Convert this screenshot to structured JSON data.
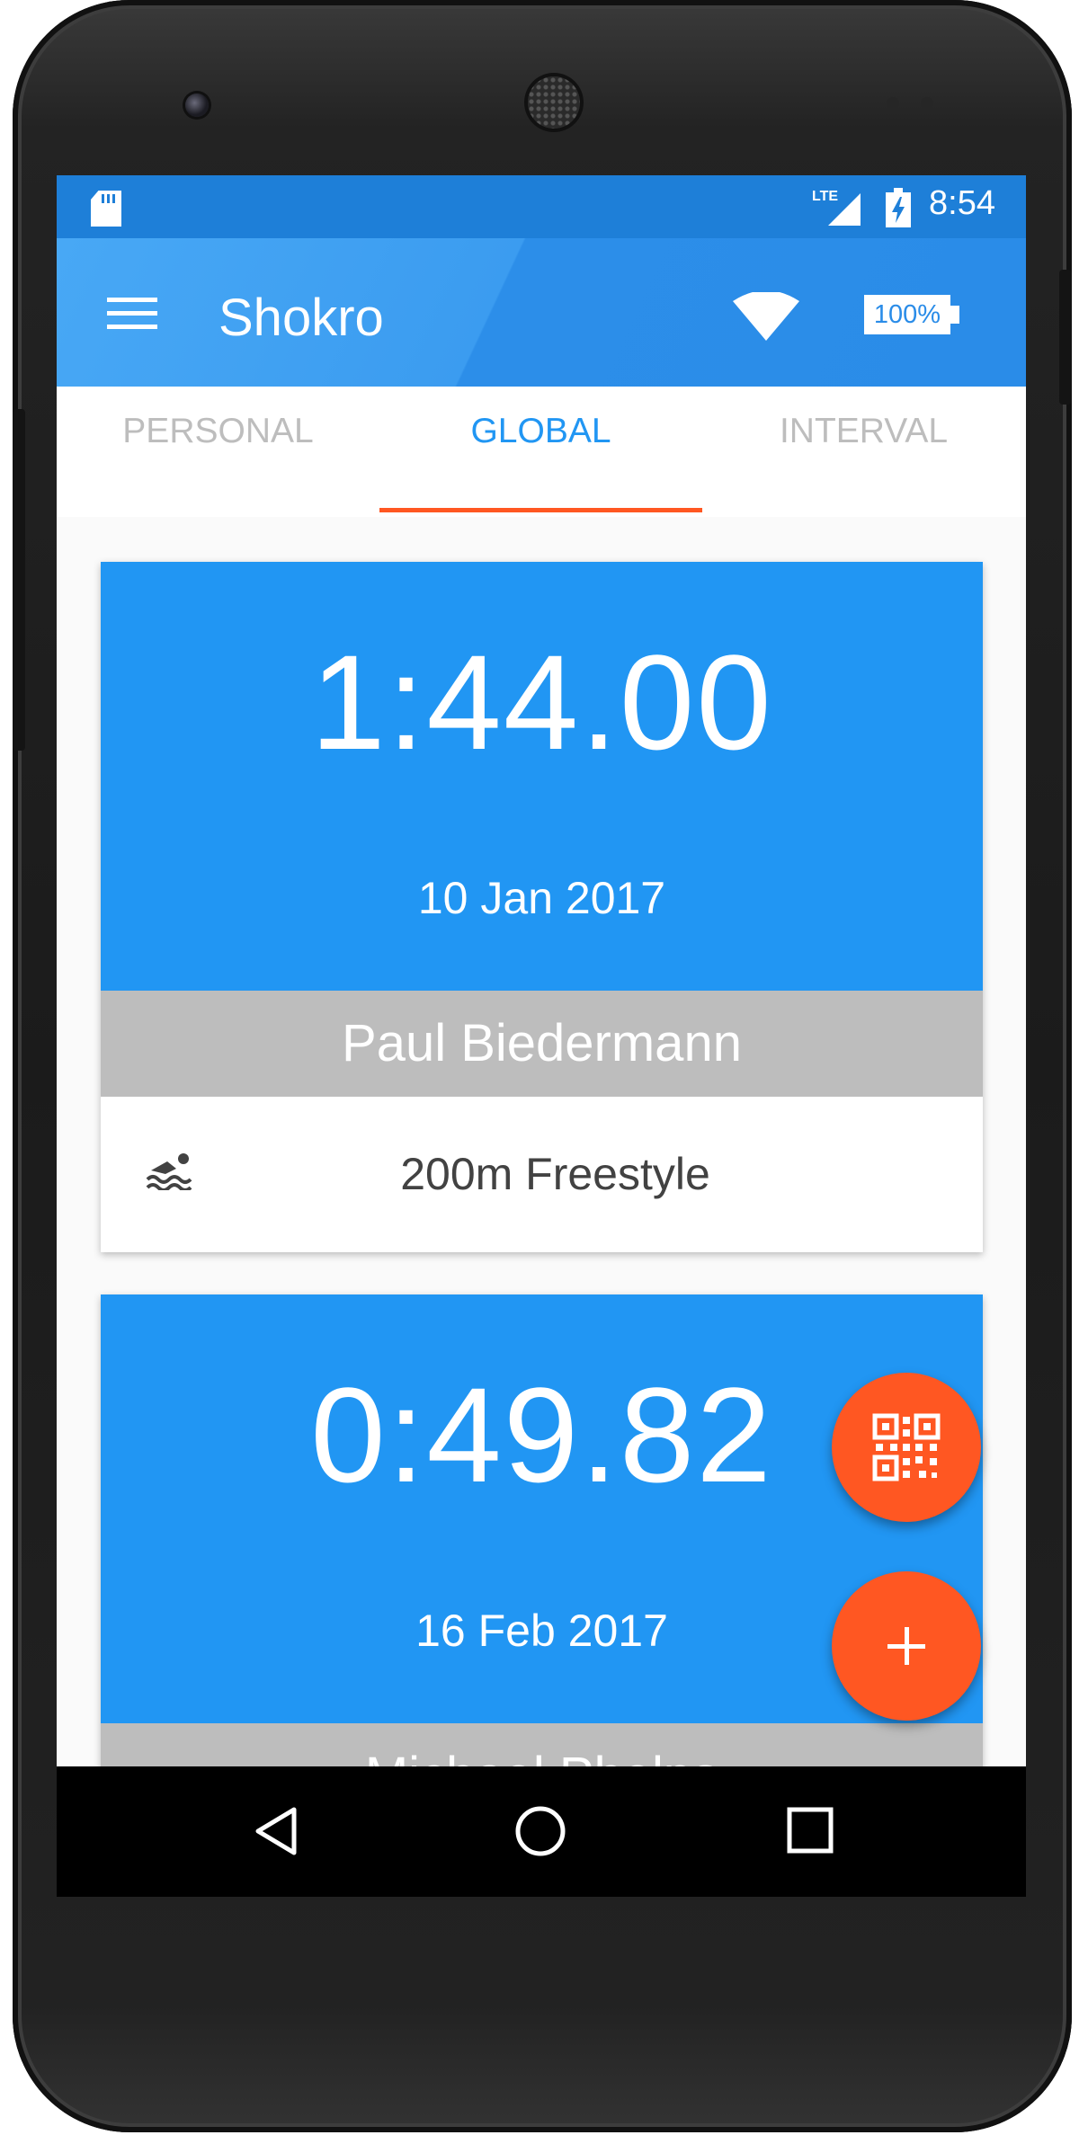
{
  "status_bar": {
    "network": "LTE",
    "time": "8:54"
  },
  "app_bar": {
    "title": "Shokro",
    "battery_label": "100%",
    "icons": [
      "menu-icon",
      "wifi-icon",
      "battery-icon"
    ]
  },
  "tabs": [
    {
      "label": "PERSONAL",
      "selected": false
    },
    {
      "label": "GLOBAL",
      "selected": true
    },
    {
      "label": "INTERVAL",
      "selected": false
    }
  ],
  "cards": [
    {
      "time": "1:44.00",
      "date": "10 Jan 2017",
      "name": "Paul Biedermann",
      "event": "200m Freestyle",
      "event_icon": "swimmer-icon"
    },
    {
      "time": "0:49.82",
      "date": "16 Feb 2017",
      "name": "Michael Phelps"
    }
  ],
  "fabs": {
    "qr": "qr-code-icon",
    "add": "add-icon"
  },
  "navigation": [
    "back",
    "home",
    "recents"
  ],
  "colors": {
    "primary": "#2196f3",
    "status_bar": "#1e7fd8",
    "accent": "#ff5722",
    "name_band": "#bdbdbd",
    "tab_inactive": "#bdbdbd"
  }
}
